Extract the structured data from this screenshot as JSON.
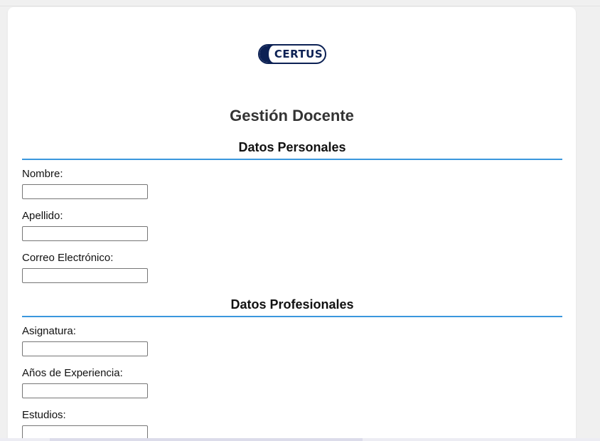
{
  "logo": {
    "text": "CERTUS"
  },
  "page": {
    "title": "Gestión Docente"
  },
  "sections": {
    "personal": {
      "title": "Datos Personales",
      "fields": [
        {
          "label": "Nombre:",
          "value": ""
        },
        {
          "label": "Apellido:",
          "value": ""
        },
        {
          "label": "Correo Electrónico:",
          "value": ""
        }
      ]
    },
    "professional": {
      "title": "Datos Profesionales",
      "fields": [
        {
          "label": "Asignatura:",
          "value": ""
        },
        {
          "label": "Años de Experiencia:",
          "value": ""
        },
        {
          "label": "Estudios:",
          "value": ""
        }
      ]
    }
  },
  "colors": {
    "accent": "#3a97dd",
    "brand": "#0c2154"
  }
}
